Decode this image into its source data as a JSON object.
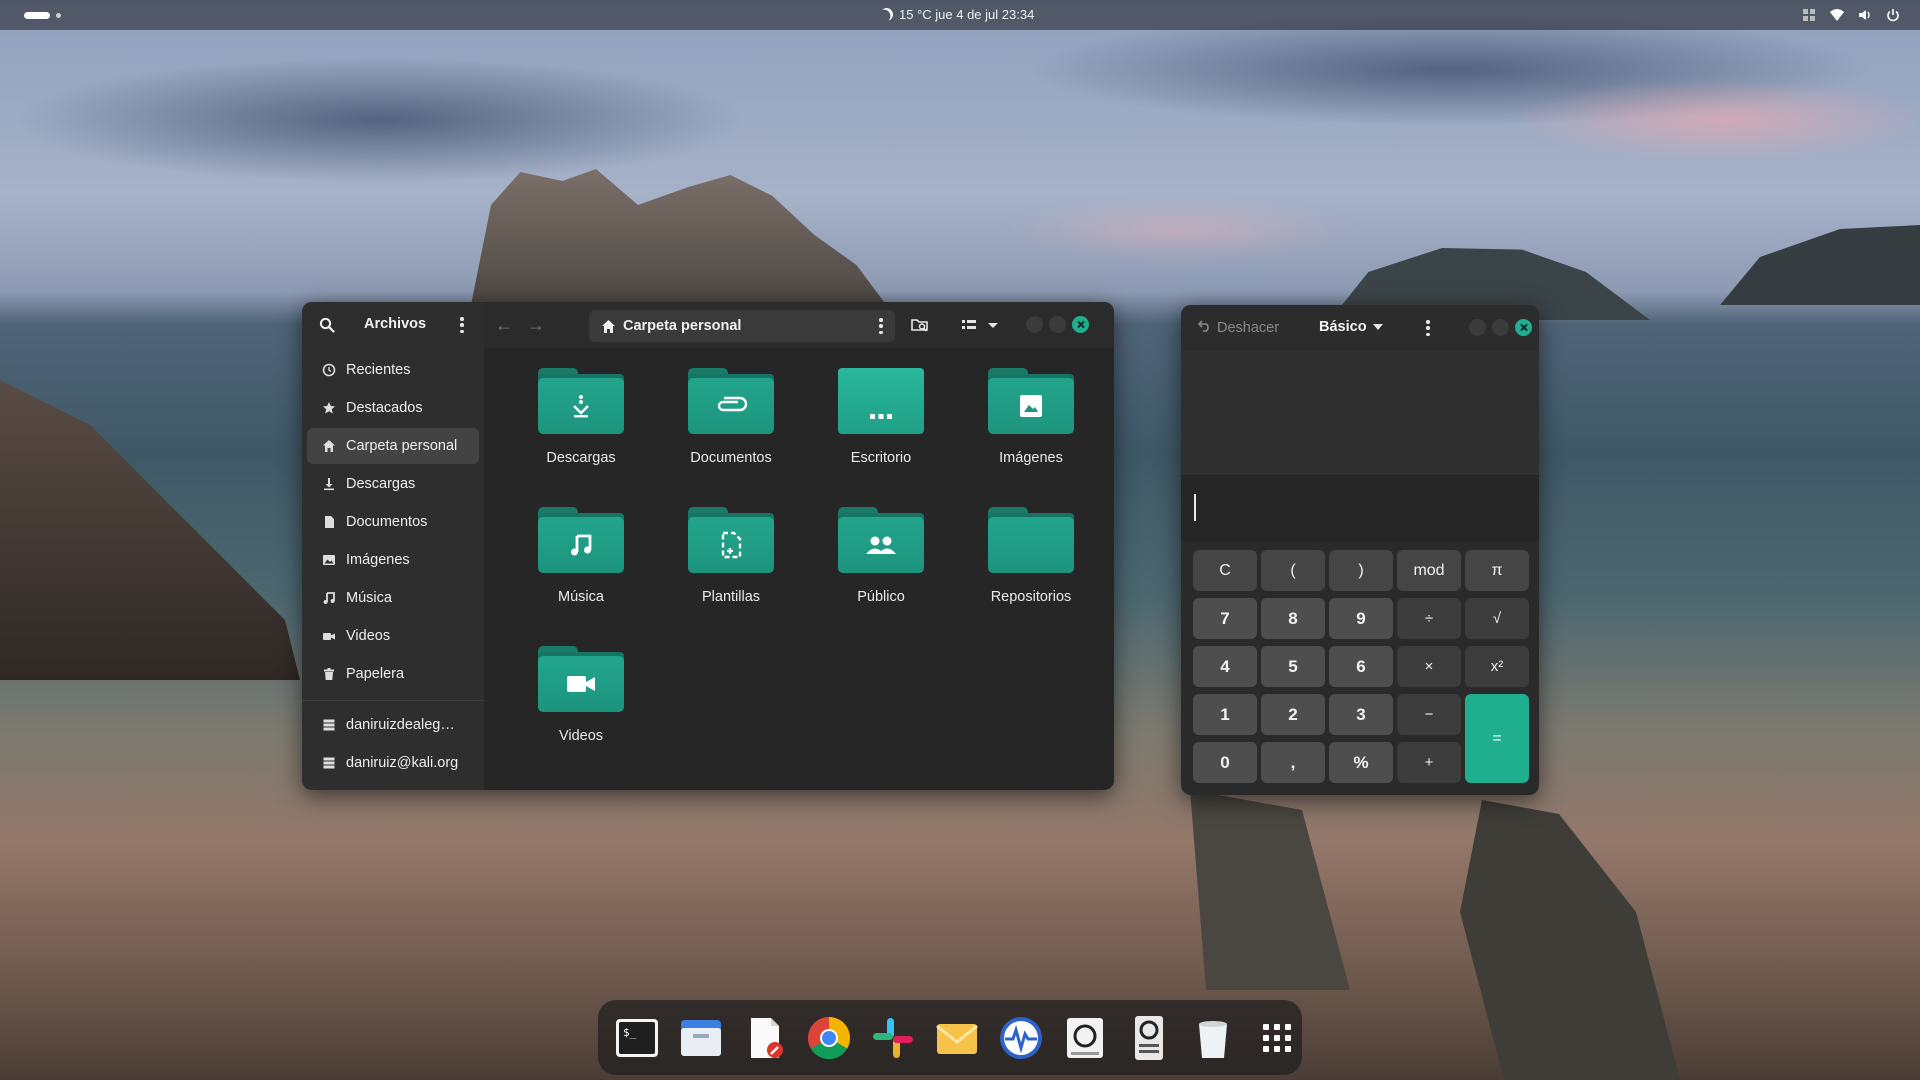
{
  "topbar": {
    "clock": "15 °C  jue 4 de jul  23:34"
  },
  "files": {
    "app_title": "Archivos",
    "path": "Carpeta personal",
    "sidebar": [
      {
        "label": "Recientes",
        "icon": "clock-icon",
        "active": false
      },
      {
        "label": "Destacados",
        "icon": "star-icon",
        "active": false
      },
      {
        "label": "Carpeta personal",
        "icon": "home-icon",
        "active": true
      },
      {
        "label": "Descargas",
        "icon": "download-icon",
        "active": false
      },
      {
        "label": "Documentos",
        "icon": "document-icon",
        "active": false
      },
      {
        "label": "Imágenes",
        "icon": "image-icon",
        "active": false
      },
      {
        "label": "Música",
        "icon": "music-icon",
        "active": false
      },
      {
        "label": "Videos",
        "icon": "video-icon",
        "active": false
      },
      {
        "label": "Papelera",
        "icon": "trash-icon",
        "active": false
      }
    ],
    "accounts": [
      {
        "label": "daniruizdealeg…",
        "icon": "server-icon"
      },
      {
        "label": "daniruiz@kali.org",
        "icon": "server-icon"
      }
    ],
    "folders": [
      {
        "label": "Descargas",
        "icon": "download-glyph"
      },
      {
        "label": "Documentos",
        "icon": "paperclip-glyph"
      },
      {
        "label": "Escritorio",
        "icon": "desktop-glyph"
      },
      {
        "label": "Imágenes",
        "icon": "picture-glyph"
      },
      {
        "label": "Música",
        "icon": "music-glyph"
      },
      {
        "label": "Plantillas",
        "icon": "template-glyph"
      },
      {
        "label": "Público",
        "icon": "people-glyph"
      },
      {
        "label": "Repositorios",
        "icon": "none"
      },
      {
        "label": "Videos",
        "icon": "camera-glyph"
      }
    ]
  },
  "calculator": {
    "undo_label": "Deshacer",
    "mode_label": "Básico",
    "entry_value": "",
    "keys": [
      {
        "label": "C",
        "kind": "fn"
      },
      {
        "label": "(",
        "kind": "fn"
      },
      {
        "label": ")",
        "kind": "fn"
      },
      {
        "label": "mod",
        "kind": "fn"
      },
      {
        "label": "π",
        "kind": "fn"
      },
      {
        "label": "7",
        "kind": "num"
      },
      {
        "label": "8",
        "kind": "num"
      },
      {
        "label": "9",
        "kind": "num"
      },
      {
        "label": "÷",
        "kind": "op"
      },
      {
        "label": "√",
        "kind": "op"
      },
      {
        "label": "4",
        "kind": "num"
      },
      {
        "label": "5",
        "kind": "num"
      },
      {
        "label": "6",
        "kind": "num"
      },
      {
        "label": "×",
        "kind": "op"
      },
      {
        "label": "x²",
        "kind": "op"
      },
      {
        "label": "1",
        "kind": "num"
      },
      {
        "label": "2",
        "kind": "num"
      },
      {
        "label": "3",
        "kind": "num"
      },
      {
        "label": "−",
        "kind": "op"
      },
      {
        "label": "=",
        "kind": "eq"
      },
      {
        "label": "0",
        "kind": "num"
      },
      {
        "label": ",",
        "kind": "num"
      },
      {
        "label": "%",
        "kind": "num"
      },
      {
        "label": "+",
        "kind": "op"
      }
    ]
  },
  "dock": {
    "apps": [
      {
        "name": "terminal",
        "label": "$_"
      },
      {
        "name": "files"
      },
      {
        "name": "text-editor"
      },
      {
        "name": "chrome"
      },
      {
        "name": "slack"
      },
      {
        "name": "mail"
      },
      {
        "name": "system-monitor"
      },
      {
        "name": "disk-utility"
      },
      {
        "name": "disk-usage"
      },
      {
        "name": "trash"
      },
      {
        "name": "app-grid"
      }
    ]
  },
  "colors": {
    "accent": "#1fae8e",
    "folder": "#22a58c",
    "window_bg": "#242424",
    "sidebar_bg": "#2e2e2e"
  }
}
